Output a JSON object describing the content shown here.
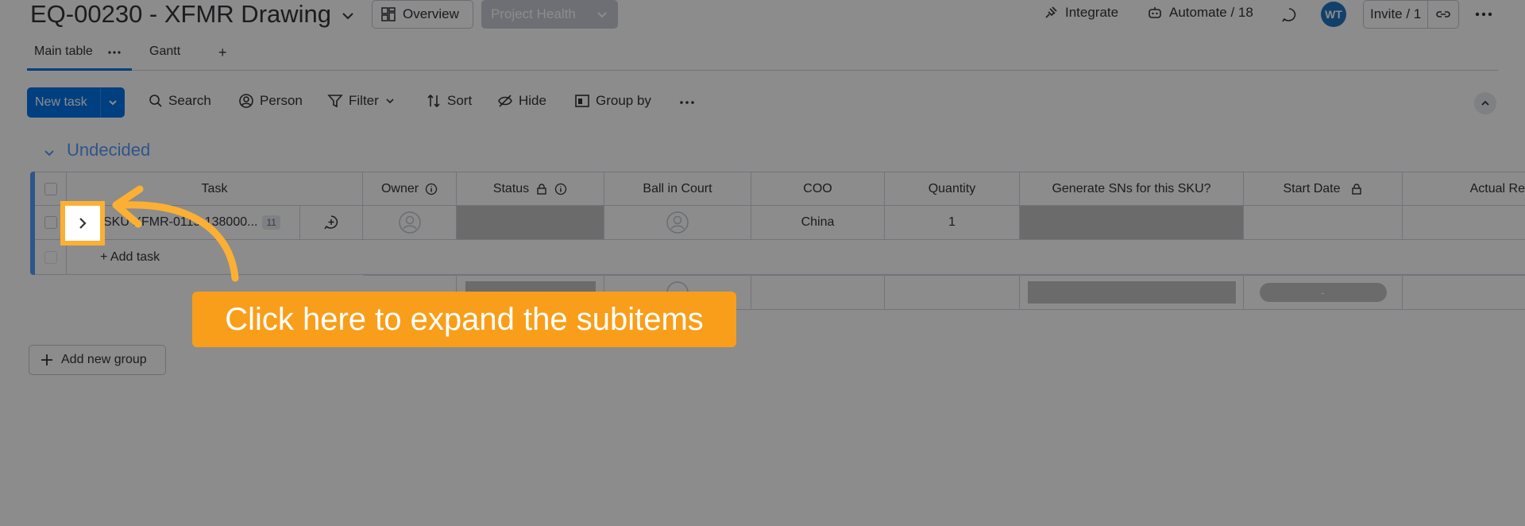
{
  "header": {
    "board_title": "EQ-00230 - XFMR Drawing",
    "overview_label": "Overview",
    "project_health_label": "Project Health",
    "integrate_label": "Integrate",
    "automate_label": "Automate / 18",
    "avatar_initials": "WT",
    "invite_label": "Invite / 1"
  },
  "tabs": {
    "main_table": "Main table",
    "gantt": "Gantt",
    "add": "+"
  },
  "toolbar": {
    "new_task": "New task",
    "search": "Search",
    "person": "Person",
    "filter": "Filter",
    "sort": "Sort",
    "hide": "Hide",
    "group_by": "Group by"
  },
  "group": {
    "title": "Undecided",
    "columns": {
      "task": "Task",
      "owner": "Owner",
      "status": "Status",
      "ball_in_court": "Ball in Court",
      "coo": "COO",
      "quantity": "Quantity",
      "generate_sns": "Generate SNs for this SKU?",
      "start_date": "Start Date",
      "actual": "Actual Re"
    },
    "row": {
      "task_name": "SKU XFMR-0115-138000...",
      "subitem_count": "11",
      "coo": "China",
      "quantity": "1"
    },
    "add_task": "+ Add task",
    "summary_date": "-"
  },
  "add_new_group": "Add new group",
  "tutorial": {
    "callout_text": "Click here to expand the subitems"
  },
  "colors": {
    "primary": "#0073ea",
    "group": "#579bfc",
    "callout": "#f99e1a",
    "highlight_border": "#fbb034"
  }
}
